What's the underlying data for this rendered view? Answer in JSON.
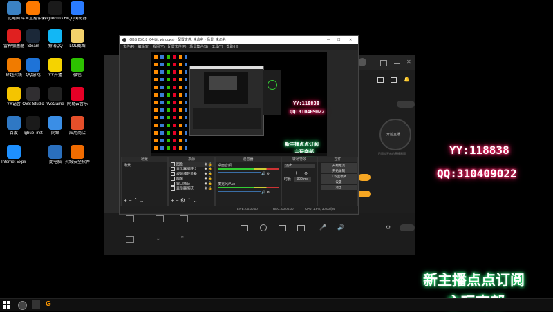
{
  "desktop": {
    "icons": [
      {
        "label": "此电脑",
        "color": "#3b82c4"
      },
      {
        "label": "斗鱼直播伴侣",
        "color": "#ff7a00"
      },
      {
        "label": "Logitech G HUB",
        "color": "#1a1a1a"
      },
      {
        "label": "QQ浏览器",
        "color": "#2a7bff"
      },
      {
        "label": "雷神加速器",
        "color": "#e02020"
      },
      {
        "label": "Steam",
        "color": "#1b2838"
      },
      {
        "label": "腾讯QQ",
        "color": "#12b7f5"
      },
      {
        "label": "LOL截图",
        "color": "#f2d16b"
      },
      {
        "label": "穿越火线",
        "color": "#f07b00"
      },
      {
        "label": "QQ游戏",
        "color": "#1e73d8"
      },
      {
        "label": "YY开播",
        "color": "#f5d300"
      },
      {
        "label": "微信",
        "color": "#2dc100"
      },
      {
        "label": "YY语音",
        "color": "#f5c400"
      },
      {
        "label": "OBS Studio",
        "color": "#302e31"
      },
      {
        "label": "WeGame",
        "color": "#222"
      },
      {
        "label": "网易云音乐",
        "color": "#e60026"
      },
      {
        "label": "百度",
        "color": "#2f78c4"
      },
      {
        "label": "lghub_inst",
        "color": "#1a1a1a"
      },
      {
        "label": "网络",
        "color": "#3a8ee6"
      },
      {
        "label": "应用商店",
        "color": "#e54f2a"
      },
      {
        "label": "Internet Explorer",
        "color": "#1e90ff"
      },
      {
        "label": "",
        "color": "#000"
      },
      {
        "label": "此电脑",
        "color": "#2a6fbd"
      },
      {
        "label": "火绒安全软件",
        "color": "#f06b00"
      }
    ]
  },
  "obs": {
    "title": "OBS 25.0.8 (64-bit, windows) - 配置文件: 未命名 - 场景: 未命名",
    "menu": [
      "文件(F)",
      "编辑(E)",
      "视图(V)",
      "配置文件(P)",
      "场景集合(S)",
      "工具(T)",
      "帮助(H)"
    ],
    "docks": {
      "scenes": {
        "header": "场景",
        "items": [
          "场景"
        ]
      },
      "sources": {
        "header": "来源",
        "items": [
          "图像",
          "显示器捕获 2",
          "视频捕获设备",
          "图像",
          "窗口捕获",
          "显示器捕获"
        ]
      },
      "mixer": {
        "header": "混音器",
        "tracks": [
          "桌面音频",
          "麦克风/Aux"
        ]
      },
      "transitions": {
        "header": "转场特效",
        "type": "淡出",
        "duration_label": "时长",
        "duration": "300 ms"
      },
      "controls": {
        "header": "控件",
        "buttons": [
          "开始推流",
          "开始录制",
          "工作室模式",
          "设置",
          "退出"
        ]
      }
    },
    "status": {
      "live": "LIVE: 00:00:00",
      "rec": "REC: 00:00:00",
      "cpu": "CPU: 1.6%, 30.00 fps"
    }
  },
  "overlay": {
    "yy": "YY:118838",
    "qq": "QQ:310409022",
    "caption_line1": "新主播点点订阅",
    "caption_line2": "主玩南部"
  },
  "bgapp": {
    "start_label": "开始直播",
    "orange_label": "",
    "notice": "已同步开启的直播画面"
  }
}
